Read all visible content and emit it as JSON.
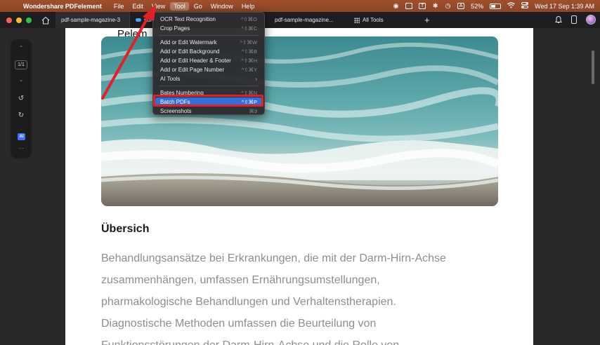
{
  "menubar": {
    "apple_glyph": "",
    "app_name": "Wondershare PDFelement",
    "menus": [
      "File",
      "Edit",
      "View",
      "Tool",
      "Go",
      "Window",
      "Help"
    ],
    "active_menu": "Tool",
    "status": {
      "letter_icon": "A",
      "battery_percent": "52%",
      "battery_level": 0.52,
      "date_time": "Wed 17 Sep  1:39 AM"
    }
  },
  "tabs": {
    "tab1": "pdf-sample-magazine-3",
    "tab2": "pdf",
    "tab3": "pdf-sample-magazine...",
    "tab4": "All Tools"
  },
  "left_toolbar": {
    "page_indicator": "1/1",
    "ai_label": "AI"
  },
  "document": {
    "partial_title": "Pelem",
    "heading": "Übersich",
    "body_lines": [
      "Behandlungsansätze bei Erkrankungen, die mit der Darm-Hirn-Achse",
      "zusammenhängen, umfassen Ernährungsumstellungen,",
      "pharmakologische Behandlungen und Verhaltenstherapien.",
      "Diagnostische Methoden umfassen die Beurteilung von",
      "Funktionsstörungen der Darm-Hirn-Achse und die Rolle von"
    ]
  },
  "dropdown": {
    "items": [
      {
        "label": "OCR Text Recognition",
        "shortcut": "^⇧⌘O"
      },
      {
        "label": "Crop Pages",
        "shortcut": "^⇧⌘C"
      },
      {
        "label": "Add or Edit Watermark",
        "shortcut": "^⇧⌘W"
      },
      {
        "label": "Add or Edit Background",
        "shortcut": "^⇧⌘B"
      },
      {
        "label": "Add or Edit Header & Footer",
        "shortcut": "^⇧⌘H"
      },
      {
        "label": "Add or Edit Page Number",
        "shortcut": "^⇧⌘Y"
      },
      {
        "label": "AI Tools",
        "shortcut": "›"
      },
      {
        "label": "Bates Numbering",
        "shortcut": "^⇧⌘N"
      },
      {
        "label": "Batch PDFs",
        "shortcut": "^⇧⌘P"
      },
      {
        "label": "Screenshots",
        "shortcut": "⌘9"
      }
    ],
    "highlighted": "Batch PDFs"
  },
  "colors": {
    "menubar": "#9a4b2a",
    "highlight": "#2f6fde",
    "annotation": "#e3202a"
  }
}
